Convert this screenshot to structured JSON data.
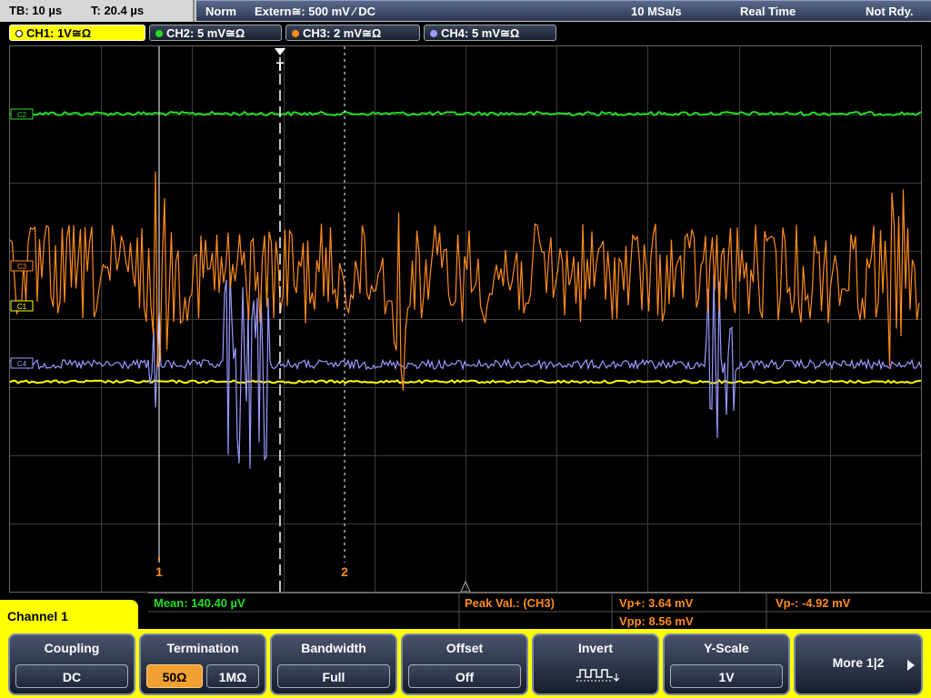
{
  "topbar": {
    "timebase": "TB: 10 µs",
    "trigger_time": "T: 20.4 µs",
    "mode": "Norm",
    "trigger_source": "Extern≅: 500 mV ⁄ DC",
    "sample_rate": "10 MSa/s",
    "acq_mode": "Real Time",
    "status": "Not Rdy."
  },
  "channels": [
    {
      "label": "CH1: 1V≅Ω",
      "color": "#ffff00",
      "active": true
    },
    {
      "label": "CH2: 5 mV≅Ω",
      "color": "#22dd22",
      "active": false
    },
    {
      "label": "CH3: 2 mV≅Ω",
      "color": "#ff8c1a",
      "active": false
    },
    {
      "label": "CH4: 5 mV≅Ω",
      "color": "#9a9aff",
      "active": false
    }
  ],
  "markers": {
    "trigger": "T",
    "cursor1": "1",
    "cursor2": "2",
    "ch2_tag": "C2",
    "ch3_tag": "C3",
    "ch1_tag": "C1",
    "ch4_tag": "C4"
  },
  "measurements": {
    "mean": "Mean: 140.40 µV",
    "peak_label": "Peak Val.:  (CH3)",
    "vp_plus": "Vp+: 3.64 mV",
    "vp_minus": "Vp-: -4.92 mV",
    "vpp": "Vpp: 8.56 mV"
  },
  "panel_title": "Channel 1",
  "softkeys": {
    "coupling": {
      "title": "Coupling",
      "value": "DC"
    },
    "termination": {
      "title": "Termination",
      "opt1": "50Ω",
      "opt2": "1MΩ"
    },
    "bandwidth": {
      "title": "Bandwidth",
      "value": "Full"
    },
    "offset": {
      "title": "Offset",
      "value": "Off"
    },
    "invert": {
      "title": "Invert",
      "icon": "square-wave-icon"
    },
    "yscale": {
      "title": "Y-Scale",
      "value": "1V"
    },
    "more": {
      "label": "More 1|2"
    }
  },
  "colors": {
    "ch1": "#ffff00",
    "ch2": "#22dd22",
    "ch3": "#ff8c1a",
    "ch4": "#9a9aff",
    "grid": "#3c3c3c"
  }
}
